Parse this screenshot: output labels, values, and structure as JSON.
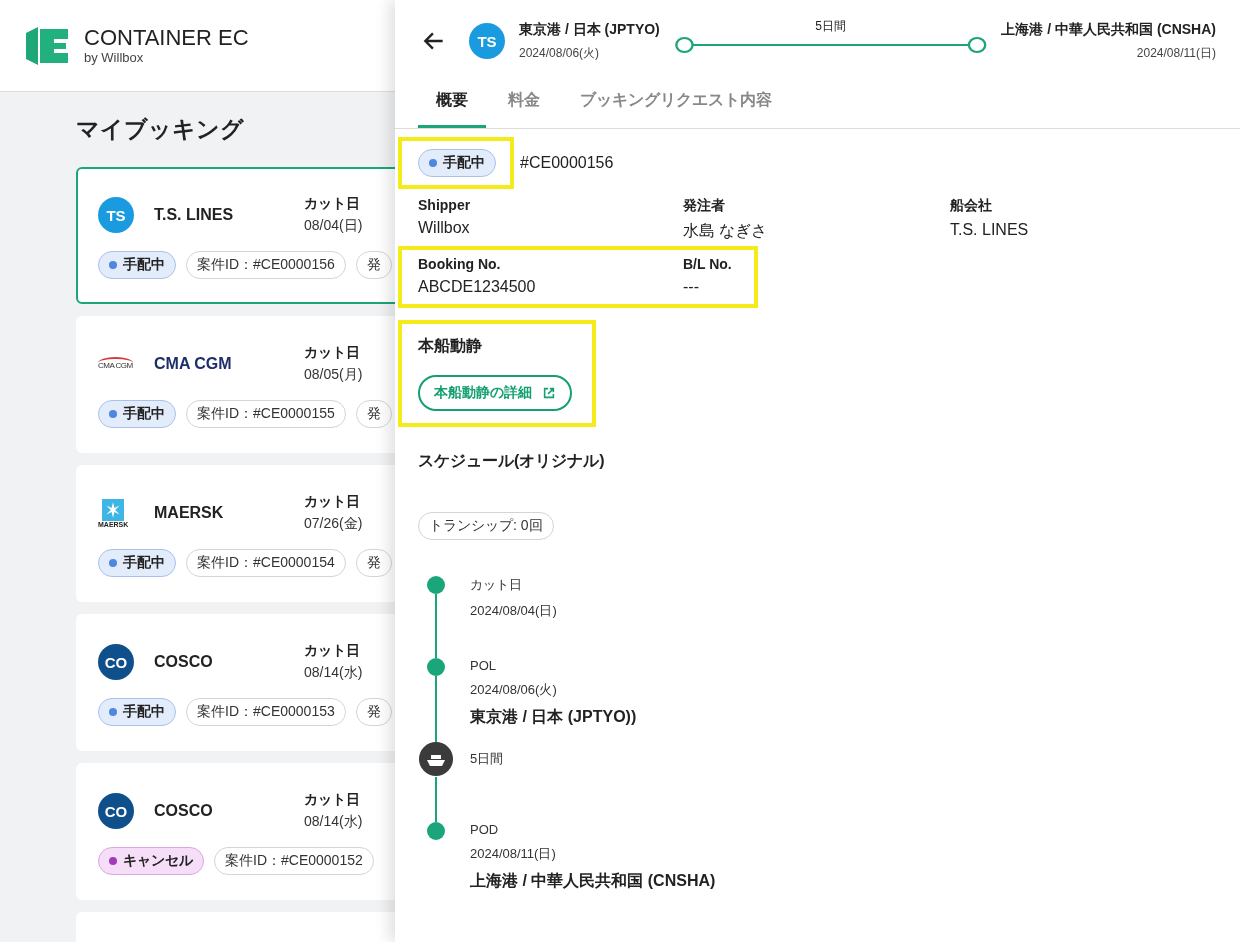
{
  "brand": {
    "name": "CONTAINER EC",
    "tagline": "by Willbox"
  },
  "page_title": "マイブッキング",
  "bookings": [
    {
      "selected": true,
      "logo": {
        "kind": "circle",
        "text": "TS",
        "color": "#1a9be0"
      },
      "carrier": "T.S. LINES",
      "cut_label": "カット日",
      "cut_date": "08/04(日)",
      "status": {
        "kind": "arranging",
        "label": "手配中",
        "color": "#4f86e0"
      },
      "case_id": "案件ID：#CE0000156",
      "extra_chip": "発"
    },
    {
      "selected": false,
      "logo": {
        "kind": "cma",
        "text": "CMA CGM"
      },
      "carrier": "CMA CGM",
      "cut_label": "カット日",
      "cut_date": "08/05(月)",
      "status": {
        "kind": "arranging",
        "label": "手配中",
        "color": "#4f86e0"
      },
      "case_id": "案件ID：#CE0000155",
      "extra_chip": "発"
    },
    {
      "selected": false,
      "logo": {
        "kind": "maersk",
        "text": "MAERSK"
      },
      "carrier": "MAERSK",
      "cut_label": "カット日",
      "cut_date": "07/26(金)",
      "status": {
        "kind": "arranging",
        "label": "手配中",
        "color": "#4f86e0"
      },
      "case_id": "案件ID：#CE0000154",
      "extra_chip": "発"
    },
    {
      "selected": false,
      "logo": {
        "kind": "circle",
        "text": "CO",
        "color": "#0e4f8c"
      },
      "carrier": "COSCO",
      "cut_label": "カット日",
      "cut_date": "08/14(水)",
      "status": {
        "kind": "arranging",
        "label": "手配中",
        "color": "#4f86e0"
      },
      "case_id": "案件ID：#CE0000153",
      "extra_chip": "発"
    },
    {
      "selected": false,
      "logo": {
        "kind": "circle",
        "text": "CO",
        "color": "#0e4f8c"
      },
      "carrier": "COSCO",
      "cut_label": "カット日",
      "cut_date": "08/14(水)",
      "status": {
        "kind": "cancelled",
        "label": "キャンセル",
        "color": "#a23bb5"
      },
      "case_id": "案件ID：#CE0000152"
    }
  ],
  "drawer": {
    "header": {
      "avatar": "TS",
      "origin": {
        "port": "東京港 / 日本 (JPTYO)",
        "date": "2024/08/06(火)"
      },
      "duration": "5日間",
      "destination": {
        "port": "上海港 / 中華人民共和国 (CNSHA)",
        "date": "2024/08/11(日)"
      }
    },
    "tabs": [
      {
        "label": "概要",
        "selected": true
      },
      {
        "label": "料金",
        "selected": false
      },
      {
        "label": "ブッキングリクエスト内容",
        "selected": false
      }
    ],
    "status": {
      "kind": "arranging",
      "label": "手配中",
      "color": "#4f86e0",
      "highlighted": true
    },
    "case_number": "#CE0000156",
    "fields": [
      {
        "label": "Shipper",
        "value": "Willbox"
      },
      {
        "label": "発注者",
        "value": "水島 なぎさ"
      },
      {
        "label": "船会社",
        "value": "T.S. LINES"
      }
    ],
    "booking_fields": {
      "highlighted": true,
      "items": [
        {
          "label": "Booking No.",
          "value": "ABCDE1234500"
        },
        {
          "label": "B/L No.",
          "value": "---"
        }
      ]
    },
    "vessel": {
      "highlighted": true,
      "title": "本船動静",
      "button": "本船動静の詳細"
    },
    "schedule_title": "スケジュール(オリジナル)",
    "transship": "トランシップ: 0回",
    "timeline": [
      {
        "kind": "point",
        "label": "カット日",
        "date": "2024/08/04(日)"
      },
      {
        "kind": "point",
        "label": "POL",
        "date": "2024/08/06(火)",
        "place": "東京港 / 日本 (JPTYO))"
      },
      {
        "kind": "voyage",
        "label": "5日間"
      },
      {
        "kind": "point",
        "label": "POD",
        "date": "2024/08/11(日)",
        "place": "上海港 / 中華人民共和国 (CNSHA)"
      }
    ]
  }
}
